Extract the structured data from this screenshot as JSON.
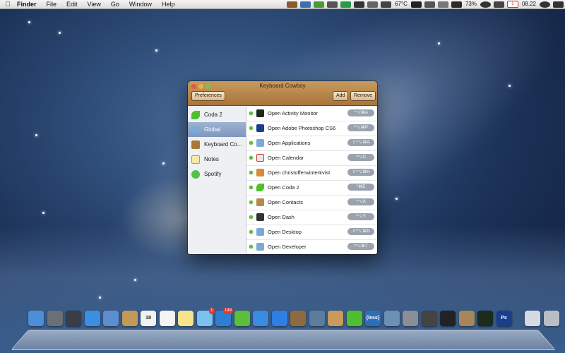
{
  "menubar": {
    "app_name": "Finder",
    "menus": [
      "File",
      "Edit",
      "View",
      "Go",
      "Window",
      "Help"
    ],
    "status": {
      "temperature": "67°C",
      "battery": "73%",
      "calendar_day": "1",
      "time": "08.22"
    }
  },
  "window": {
    "title": "Keyboard Cowboy",
    "toolbar": {
      "preferences_label": "Preferences",
      "add_label": "Add",
      "remove_label": "Remove"
    },
    "sidebar": {
      "items": [
        {
          "label": "Coda 2",
          "icon": "coda-icon"
        },
        {
          "label": "Global",
          "icon": "folder-icon",
          "selected": true
        },
        {
          "label": "Keyboard Co...",
          "icon": "keyboard-cowboy-icon"
        },
        {
          "label": "Notes",
          "icon": "notes-icon"
        },
        {
          "label": "Spotify",
          "icon": "spotify-icon"
        }
      ]
    },
    "shortcuts": [
      {
        "label": "Open Activity Monitor",
        "keys": "^⌥⌘A",
        "icon": "activity-monitor-icon",
        "color": "#1d2b1d"
      },
      {
        "label": "Open Adobe Photoshop CS6",
        "keys": "^⌥⌘P",
        "icon": "photoshop-icon",
        "color": "#1b3e8c"
      },
      {
        "label": "Open Applications",
        "keys": "⇧^⌥⌘A",
        "icon": "applications-folder-icon",
        "color": "#7da9d8"
      },
      {
        "label": "Open Calendar",
        "keys": "^⌥C",
        "icon": "calendar-icon",
        "color": "#e9e9e9"
      },
      {
        "label": "Open christofferwinterkvist",
        "keys": "⇧^⌥⌘H",
        "icon": "home-folder-icon",
        "color": "#d98a3a"
      },
      {
        "label": "Open Coda 2",
        "keys": "^⌘E",
        "icon": "coda-icon",
        "color": "#4fbf2e"
      },
      {
        "label": "Open Contacts",
        "keys": "^⌥A",
        "icon": "contacts-icon",
        "color": "#b58a4a"
      },
      {
        "label": "Open Dash",
        "keys": "^⌥Y",
        "icon": "dash-icon",
        "color": "#333333"
      },
      {
        "label": "Open Desktop",
        "keys": "⇧^⌥⌘D",
        "icon": "desktop-folder-icon",
        "color": "#7da9d8"
      },
      {
        "label": "Open Developer",
        "keys": "^⌥⌘T",
        "icon": "developer-folder-icon",
        "color": "#7da9d8"
      }
    ]
  },
  "dock": {
    "apps": [
      {
        "name": "finder",
        "color": "#4a8fd8"
      },
      {
        "name": "launchpad",
        "color": "#6b6f78"
      },
      {
        "name": "mission-control",
        "color": "#3a3d45"
      },
      {
        "name": "safari",
        "color": "#3a8fe0"
      },
      {
        "name": "mail-stamp",
        "color": "#5d8ed0"
      },
      {
        "name": "contacts",
        "color": "#c29a56"
      },
      {
        "name": "calendar",
        "color": "#f2f2f2",
        "text": "18"
      },
      {
        "name": "reminders",
        "color": "#f4f4f4"
      },
      {
        "name": "notes",
        "color": "#f5e489"
      },
      {
        "name": "messages",
        "color": "#7cc0f0",
        "badge": "1"
      },
      {
        "name": "tweetbot",
        "color": "#2d7fd6",
        "badge": "149"
      },
      {
        "name": "spotify",
        "color": "#5bbf3c"
      },
      {
        "name": "itunes",
        "color": "#3b8be0"
      },
      {
        "name": "app-store",
        "color": "#2f7ee4"
      },
      {
        "name": "iphoto",
        "color": "#8d6b3f"
      },
      {
        "name": "preview",
        "color": "#5c7d9c"
      },
      {
        "name": "keyboard-cowboy",
        "color": "#c99a5b"
      },
      {
        "name": "coda",
        "color": "#4fbf2e"
      },
      {
        "name": "less",
        "color": "#2c6fb8",
        "text": "{less}"
      },
      {
        "name": "xcode",
        "color": "#6c8fb4"
      },
      {
        "name": "system-preferences",
        "color": "#8a8e96"
      },
      {
        "name": "utilities",
        "color": "#444"
      },
      {
        "name": "terminal",
        "color": "#222"
      },
      {
        "name": "archive",
        "color": "#a6875a"
      },
      {
        "name": "activity-monitor",
        "color": "#1d2b1d"
      },
      {
        "name": "photoshop",
        "color": "#1b3e8c",
        "text": "Ps"
      },
      {
        "name": "documents",
        "color": "#d5dbe3"
      },
      {
        "name": "trash",
        "color": "#b8bec6"
      }
    ]
  }
}
